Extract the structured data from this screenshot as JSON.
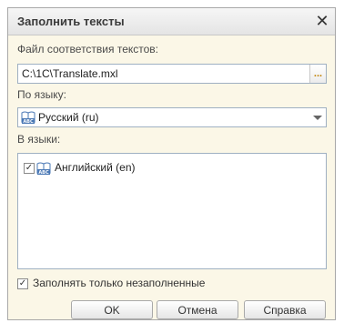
{
  "dialog": {
    "title": "Заполнить тексты",
    "close_icon": "close-icon"
  },
  "file_section": {
    "label": "Файл соответствия текстов:",
    "value": "C:\\1C\\Translate.mxl",
    "browse_label": "..."
  },
  "from_lang": {
    "label": "По языку:",
    "value": "Русский (ru)",
    "icon": "book-abc-icon"
  },
  "to_langs": {
    "label": "В языки:",
    "items": [
      {
        "label": "Английский (en)",
        "checked": true,
        "icon": "book-abc-icon"
      }
    ]
  },
  "only_empty": {
    "label": "Заполнять только незаполненные",
    "checked": true
  },
  "buttons": {
    "ok": "OK",
    "cancel": "Отмена",
    "help": "Справка"
  }
}
